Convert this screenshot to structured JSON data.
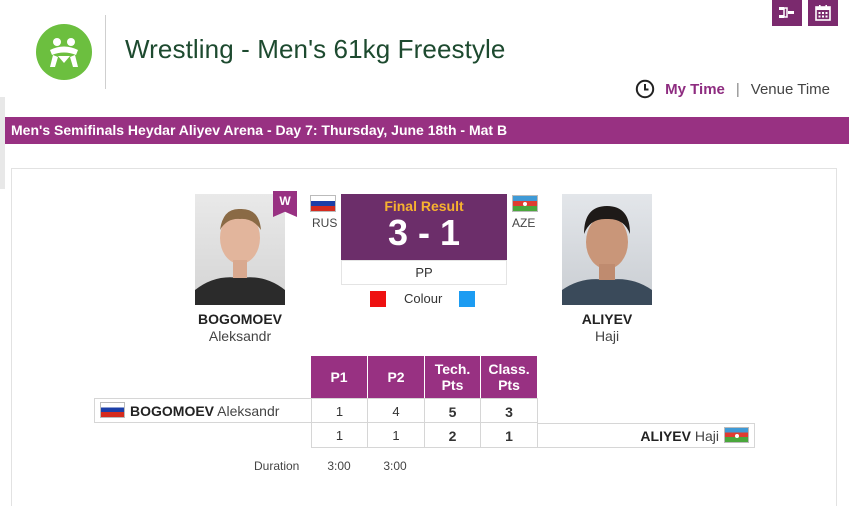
{
  "header": {
    "title": "Wrestling - Men's 61kg Freestyle",
    "logo_icon": "wrestling-pictogram-icon",
    "top_icons": [
      "bracket-icon",
      "calendar-icon"
    ]
  },
  "time_toggle": {
    "my_time": "My Time",
    "separator": "|",
    "venue_time": "Venue Time"
  },
  "session": {
    "label": "Men's Semifinals  Heydar Aliyev Arena - Day 7: Thursday, June 18th - Mat B"
  },
  "match": {
    "winner_tag": "W",
    "result_label": "Final Result",
    "score": "3 - 1",
    "result_type": "PP",
    "colour_label": "Colour",
    "red": {
      "noc": "RUS",
      "last_name": "BOGOMOEV",
      "first_name": "Aleksandr",
      "colour": "#ee1111"
    },
    "blue": {
      "noc": "AZE",
      "last_name": "ALIYEV",
      "first_name": "Haji",
      "colour": "#1c9cf2"
    }
  },
  "stats": {
    "headers": [
      "P1",
      "P2",
      "Tech. Pts",
      "Class. Pts"
    ],
    "rows": [
      {
        "last_name": "BOGOMOEV",
        "first_name": "Aleksandr",
        "values": [
          "1",
          "4",
          "5",
          "3"
        ]
      },
      {
        "last_name": "ALIYEV",
        "first_name": "Haji",
        "values": [
          "1",
          "1",
          "2",
          "1"
        ]
      }
    ],
    "duration_label": "Duration",
    "durations": [
      "3:00",
      "3:00"
    ]
  },
  "colors": {
    "accent": "#983182",
    "result_bg": "#6c2e6a",
    "result_label": "#f7b22f",
    "title": "#1d4a2f",
    "logo": "#6cbf3f"
  }
}
